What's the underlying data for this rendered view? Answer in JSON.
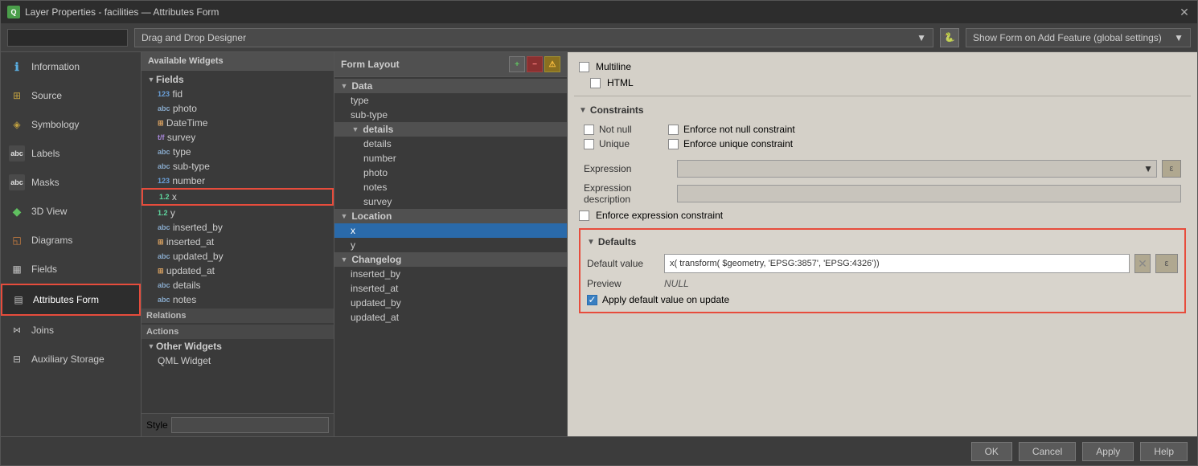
{
  "window": {
    "title": "Layer Properties - facilities — Attributes Form",
    "icon": "Q"
  },
  "toolbar": {
    "search_placeholder": "",
    "designer_dropdown": "Drag and Drop Designer",
    "python_label": "ε",
    "show_form_label": "Show Form on Add Feature (global settings)"
  },
  "sidebar": {
    "items": [
      {
        "id": "information",
        "label": "Information",
        "icon": "ℹ"
      },
      {
        "id": "source",
        "label": "Source",
        "icon": "⊞"
      },
      {
        "id": "symbology",
        "label": "Symbology",
        "icon": "◈"
      },
      {
        "id": "labels",
        "label": "Labels",
        "icon": "abc"
      },
      {
        "id": "masks",
        "label": "Masks",
        "icon": "abc"
      },
      {
        "id": "3dview",
        "label": "3D View",
        "icon": "◆"
      },
      {
        "id": "diagrams",
        "label": "Diagrams",
        "icon": "◱"
      },
      {
        "id": "fields",
        "label": "Fields",
        "icon": "▦"
      },
      {
        "id": "attributes-form",
        "label": "Attributes Form",
        "icon": "▤",
        "active": true
      },
      {
        "id": "joins",
        "label": "Joins",
        "icon": "⋈"
      },
      {
        "id": "auxiliary-storage",
        "label": "Auxiliary Storage",
        "icon": "⊟"
      }
    ]
  },
  "available_widgets": {
    "header": "Available Widgets",
    "fields_section": "Fields",
    "fields": [
      {
        "type": "123",
        "name": "fid"
      },
      {
        "type": "abc",
        "name": "photo"
      },
      {
        "type": "datetime",
        "name": "DateTime"
      },
      {
        "type": "t/f",
        "name": "survey"
      },
      {
        "type": "abc",
        "name": "type"
      },
      {
        "type": "abc",
        "name": "sub-type"
      },
      {
        "type": "123",
        "name": "number"
      },
      {
        "type": "1.2",
        "name": "x",
        "highlighted": true
      },
      {
        "type": "1.2",
        "name": "y"
      },
      {
        "type": "abc",
        "name": "inserted_by"
      },
      {
        "type": "datetime",
        "name": "inserted_at"
      },
      {
        "type": "abc",
        "name": "updated_by"
      },
      {
        "type": "datetime",
        "name": "updated_at"
      },
      {
        "type": "abc",
        "name": "details"
      },
      {
        "type": "abc",
        "name": "notes"
      }
    ],
    "relations_label": "Relations",
    "actions_label": "Actions",
    "other_widgets_label": "Other Widgets",
    "qml_widget": "QML Widget",
    "style_label": "Style"
  },
  "form_layout": {
    "header": "Form Layout",
    "groups": [
      {
        "name": "Data",
        "items": [
          {
            "name": "type",
            "indent": 2
          },
          {
            "name": "sub-type",
            "indent": 2
          },
          {
            "name": "details",
            "indent": 1,
            "is_group": true,
            "items": [
              {
                "name": "details",
                "indent": 3
              },
              {
                "name": "number",
                "indent": 3
              },
              {
                "name": "photo",
                "indent": 3
              },
              {
                "name": "notes",
                "indent": 3
              },
              {
                "name": "survey",
                "indent": 3
              }
            ]
          }
        ]
      },
      {
        "name": "Location",
        "items": [
          {
            "name": "x",
            "indent": 2,
            "selected": true
          },
          {
            "name": "y",
            "indent": 2
          }
        ]
      },
      {
        "name": "Changelog",
        "items": [
          {
            "name": "inserted_by",
            "indent": 2
          },
          {
            "name": "inserted_at",
            "indent": 2
          },
          {
            "name": "updated_by",
            "indent": 2
          },
          {
            "name": "updated_at",
            "indent": 2
          }
        ]
      }
    ]
  },
  "right_panel": {
    "multiline_label": "Multiline",
    "html_label": "HTML",
    "constraints_title": "Constraints",
    "not_null_label": "Not null",
    "enforce_not_null_label": "Enforce not null constraint",
    "unique_label": "Unique",
    "enforce_unique_label": "Enforce unique constraint",
    "expression_label": "Expression",
    "expression_desc_label": "Expression description",
    "enforce_expr_label": "Enforce expression constraint",
    "defaults_title": "Defaults",
    "default_value_label": "Default value",
    "default_value": "x( transform( $geometry, 'EPSG:3857', 'EPSG:4326'))",
    "preview_label": "Preview",
    "preview_value": "NULL",
    "apply_label": "Apply default value on update",
    "apply_checked": true
  },
  "bottom_buttons": {
    "ok": "OK",
    "cancel": "Cancel",
    "apply": "Apply",
    "help": "Help"
  }
}
